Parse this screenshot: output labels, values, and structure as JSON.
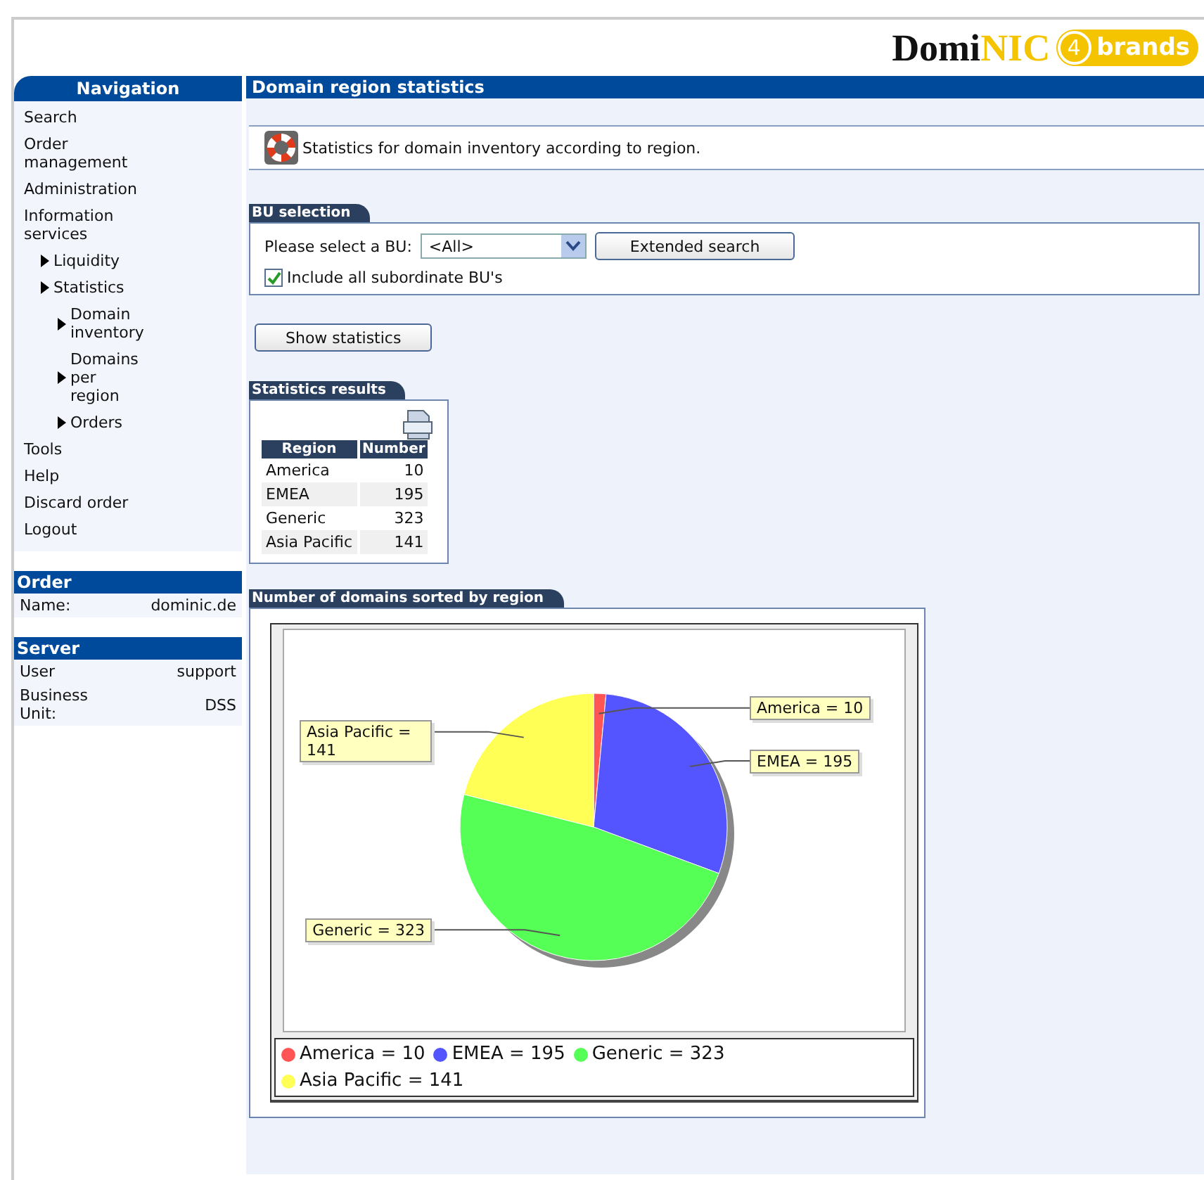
{
  "logo": {
    "text": "Domi",
    "accent": "NIC",
    "badge_digit": "4",
    "badge_text": "brands"
  },
  "navigation": {
    "title": "Navigation",
    "items": [
      {
        "label": "Search"
      },
      {
        "label": "Order management"
      },
      {
        "label": "Administration"
      },
      {
        "label": "Information services",
        "children": [
          {
            "label": "Liquidity"
          },
          {
            "label": "Statistics",
            "children": [
              {
                "label": "Domain inventory"
              },
              {
                "label": "Domains per region"
              },
              {
                "label": "Orders"
              }
            ]
          }
        ]
      },
      {
        "label": "Tools"
      },
      {
        "label": "Help"
      },
      {
        "label": "Discard order"
      },
      {
        "label": "Logout"
      }
    ]
  },
  "order_panel": {
    "title": "Order",
    "rows": [
      {
        "label": "Name:",
        "value": "dominic.de"
      }
    ]
  },
  "server_panel": {
    "title": "Server",
    "rows": [
      {
        "label": "User",
        "value": "support"
      },
      {
        "label": "Business Unit:",
        "value": "DSS"
      }
    ]
  },
  "page_title": "Domain region statistics",
  "info_text": "Statistics for domain inventory according to region.",
  "bu_selection": {
    "title": "BU selection",
    "select_label": "Please select a BU:",
    "select_value": "<All>",
    "extended_button": "Extended search",
    "include_label": "Include all subordinate BU's",
    "include_checked": true
  },
  "show_button": "Show statistics",
  "results": {
    "title": "Statistics results",
    "columns": [
      "Region",
      "Number"
    ],
    "rows": [
      {
        "region": "America",
        "number": "10"
      },
      {
        "region": "EMEA",
        "number": "195"
      },
      {
        "region": "Generic",
        "number": "323"
      },
      {
        "region": "Asia Pacific",
        "number": "141"
      }
    ]
  },
  "chart": {
    "title": "Number of domains sorted by region",
    "chart_data": {
      "type": "pie",
      "values": [
        10,
        195,
        323,
        141
      ],
      "value_labels": [
        "America = 10",
        "EMEA = 195",
        "Generic = 323",
        "Asia Pacific = 141"
      ]
    },
    "legend": [
      {
        "label": "America = 10",
        "color": "#ff5555"
      },
      {
        "label": "EMEA = 195",
        "color": "#5555ff"
      },
      {
        "label": "Generic = 323",
        "color": "#55ff55"
      },
      {
        "label": "Asia Pacific = 141",
        "color": "#ffff55"
      }
    ]
  }
}
